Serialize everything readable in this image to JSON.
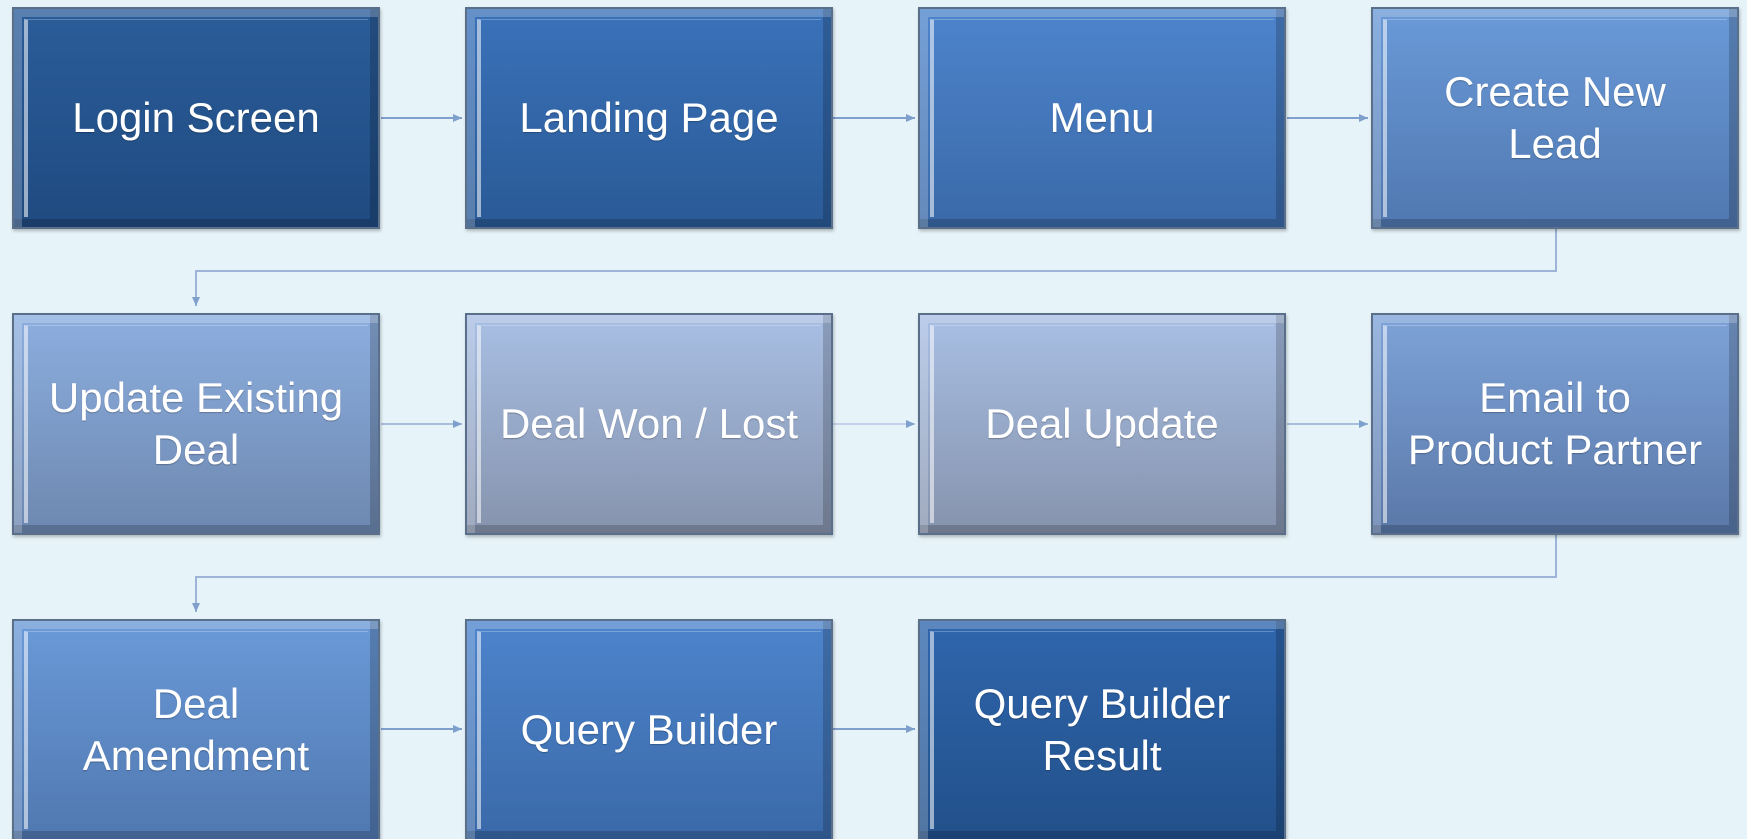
{
  "diagram": {
    "steps": [
      {
        "label": "Login Screen"
      },
      {
        "label": "Landing Page"
      },
      {
        "label": "Menu"
      },
      {
        "label": "Create New\nLead"
      },
      {
        "label": "Update Existing\nDeal"
      },
      {
        "label": "Deal Won / Lost"
      },
      {
        "label": "Deal Update"
      },
      {
        "label": "Email to\nProduct Partner"
      },
      {
        "label": "Deal\nAmendment"
      },
      {
        "label": "Query Builder"
      },
      {
        "label": "Query Builder\nResult"
      }
    ],
    "colors": {
      "background": "#e6f3f8",
      "connector": "#7f9fcc",
      "text": "#ffffff"
    }
  }
}
